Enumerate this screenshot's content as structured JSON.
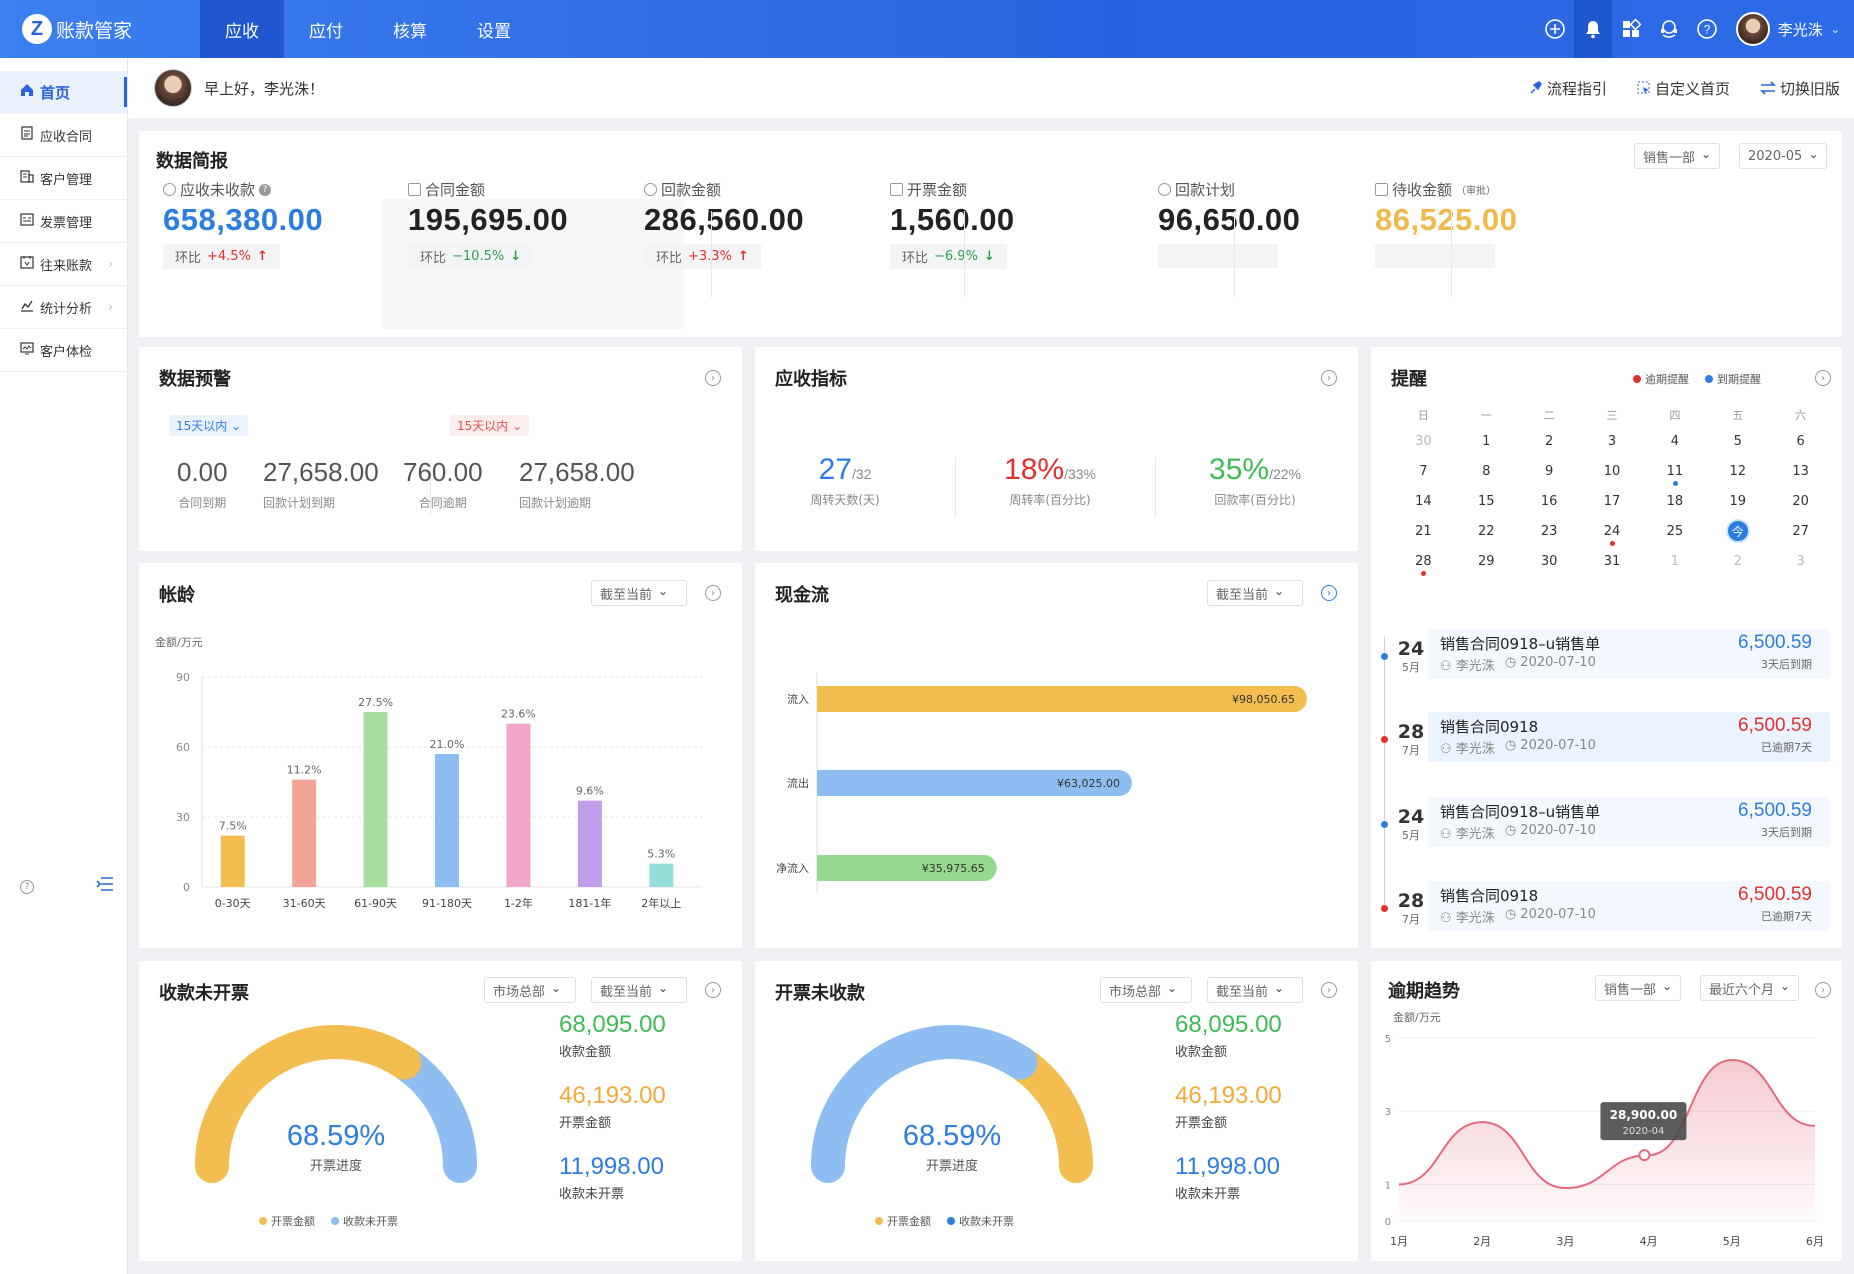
{
  "app": {
    "name": "账款管家",
    "logo_letter": "Z"
  },
  "topnav": {
    "tabs": [
      "应收",
      "应付",
      "核算",
      "设置"
    ],
    "active": 0
  },
  "user": {
    "name": "李光洙"
  },
  "sidebar": {
    "items": [
      {
        "label": "首页",
        "icon": "home-icon",
        "active": true
      },
      {
        "label": "应收合同",
        "icon": "document-icon"
      },
      {
        "label": "客户管理",
        "icon": "building-icon"
      },
      {
        "label": "发票管理",
        "icon": "invoice-icon"
      },
      {
        "label": "往来账款",
        "icon": "ledger-icon",
        "chevron": true
      },
      {
        "label": "统计分析",
        "icon": "chart-icon",
        "chevron": true
      },
      {
        "label": "客户体检",
        "icon": "monitor-icon"
      }
    ]
  },
  "greeting": {
    "text": "早上好，李光洙！",
    "links": [
      "流程指引",
      "自定义首页",
      "切换旧版"
    ]
  },
  "summary": {
    "title": "数据简报",
    "filters": [
      "销售一部",
      "2020-05"
    ],
    "stats": [
      {
        "label": "应收未收款",
        "value": "658,380.00",
        "color": "#2d7de0",
        "cmp_label": "环比",
        "cmp": "+4.5%",
        "trend": "up",
        "help": true
      },
      {
        "label": "合同金额",
        "value": "195,695.00",
        "color": "#222222",
        "cmp_label": "环比",
        "cmp": "−10.5%",
        "trend": "down"
      },
      {
        "label": "回款金额",
        "value": "286,560.00",
        "color": "#222222",
        "cmp_label": "环比",
        "cmp": "+3.3%",
        "trend": "up"
      },
      {
        "label": "开票金额",
        "value": "1,560.00",
        "color": "#222222",
        "cmp_label": "环比",
        "cmp": "−6.9%",
        "trend": "down"
      },
      {
        "label": "回款计划",
        "value": "96,650.00",
        "color": "#222222"
      },
      {
        "label": "待收金额",
        "label_note": "（审批）",
        "value": "86,525.00",
        "color": "#f0b94a"
      }
    ]
  },
  "warning": {
    "title": "数据预警",
    "tags": [
      "15天以内",
      "15天以内"
    ],
    "items": [
      {
        "value": "0.00",
        "label": "合同到期"
      },
      {
        "value": "27,658.00",
        "label": "回款计划到期"
      },
      {
        "value": "760.00",
        "label": "合同逾期"
      },
      {
        "value": "27,658.00",
        "label": "回款计划逾期"
      }
    ]
  },
  "indicators": {
    "title": "应收指标",
    "items": [
      {
        "value": "27",
        "total": "/32",
        "label": "周转天数(天)",
        "color": "#2d7de0"
      },
      {
        "value": "18%",
        "total": "/33%",
        "label": "周转率(百分比)",
        "color": "#e03030"
      },
      {
        "value": "35%",
        "total": "/22%",
        "label": "回款率(百分比)",
        "color": "#3dbb55"
      }
    ]
  },
  "reminder": {
    "title": "提醒",
    "legend": [
      {
        "label": "逾期提醒",
        "color": "#e03030"
      },
      {
        "label": "到期提醒",
        "color": "#2d7de0"
      }
    ],
    "weekdays": [
      "日",
      "一",
      "二",
      "三",
      "四",
      "五",
      "六"
    ],
    "weeks": [
      [
        "30",
        "1",
        "2",
        "3",
        "4",
        "5",
        "6"
      ],
      [
        "7",
        "8",
        "9",
        "10",
        "11",
        "12",
        "13"
      ],
      [
        "14",
        "15",
        "16",
        "17",
        "18",
        "19",
        "20"
      ],
      [
        "21",
        "22",
        "23",
        "24",
        "25",
        "今",
        "27"
      ],
      [
        "28",
        "29",
        "30",
        "31",
        "1",
        "2",
        "3"
      ]
    ],
    "items": [
      {
        "day": "24",
        "month": "5月",
        "title": "销售合同0918–u销售单",
        "user": "李光洙",
        "date": "2020-07-10",
        "amount": "6,500.59",
        "status": "3天后到期",
        "type": "due"
      },
      {
        "day": "28",
        "month": "7月",
        "title": "销售合同0918",
        "user": "李光洙",
        "date": "2020-07-10",
        "amount": "6,500.59",
        "status": "已逾期7天",
        "type": "overdue"
      },
      {
        "day": "24",
        "month": "5月",
        "title": "销售合同0918–u销售单",
        "user": "李光洙",
        "date": "2020-07-10",
        "amount": "6,500.59",
        "status": "3天后到期",
        "type": "due"
      },
      {
        "day": "28",
        "month": "7月",
        "title": "销售合同0918",
        "user": "李光洙",
        "date": "2020-07-10",
        "amount": "6,500.59",
        "status": "已逾期7天",
        "type": "overdue"
      }
    ]
  },
  "aging": {
    "title": "帐龄",
    "filter": "截至当前",
    "chart_data": {
      "type": "bar",
      "ylabel": "金额/万元",
      "ylim": [
        0,
        90
      ],
      "yticks": [
        "0",
        "30",
        "60",
        "90"
      ],
      "categories": [
        "0-30天",
        "31-60天",
        "61-90天",
        "91-180天",
        "1-2年",
        "181-1年",
        "2年以上"
      ],
      "values": [
        22,
        46,
        75,
        57,
        70,
        37,
        10
      ],
      "labels": [
        "7.5%",
        "11.2%",
        "27.5%",
        "21.0%",
        "23.6%",
        "9.6%",
        "5.3%"
      ],
      "colors": [
        "#f4bd4f",
        "#f2a596",
        "#a8e0a2",
        "#8ebdf2",
        "#f2a7c8",
        "#c19ce8",
        "#93dfdb"
      ]
    }
  },
  "cashflow": {
    "title": "现金流",
    "filter": "截至当前",
    "chart_data": {
      "type": "bar",
      "orientation": "horizontal",
      "categories": [
        "流入",
        "流出",
        "净流入"
      ],
      "values": [
        98050.65,
        63025.0,
        35975.65
      ],
      "labels": [
        "¥98,050.65",
        "¥63,025.00",
        "¥35,975.65"
      ],
      "colors": [
        "#f4bd4f",
        "#8ebdf2",
        "#94d98d"
      ]
    }
  },
  "gauge1": {
    "title": "收款未开票",
    "filters": [
      "市场总部",
      "截至当前"
    ],
    "percent": "68.59%",
    "percent_label": "开票进度",
    "fraction": 0.6859,
    "main_color": "#f4bd4f",
    "rest_color": "#8ebdf2",
    "legend": [
      {
        "label": "开票金额",
        "color": "#f4bd4f"
      },
      {
        "label": "收款未开票",
        "color": "#8ebdf2"
      }
    ],
    "stats": [
      {
        "value": "68,095.00",
        "label": "收款金额",
        "color": "#3dbb55"
      },
      {
        "value": "46,193.00",
        "label": "开票金额",
        "color": "#f0a93a"
      },
      {
        "value": "11,998.00",
        "label": "收款未开票",
        "color": "#2d7de0"
      }
    ]
  },
  "gauge2": {
    "title": "开票未收款",
    "filters": [
      "市场总部",
      "截至当前"
    ],
    "percent": "68.59%",
    "percent_label": "开票进度",
    "fraction": 0.6859,
    "main_color": "#8ebdf2",
    "rest_color": "#f4bd4f",
    "legend": [
      {
        "label": "开票金额",
        "color": "#f4bd4f"
      },
      {
        "label": "收款未开票",
        "color": "#2d7de0"
      }
    ],
    "stats": [
      {
        "value": "68,095.00",
        "label": "收款金额",
        "color": "#3dbb55"
      },
      {
        "value": "46,193.00",
        "label": "开票金额",
        "color": "#f0a93a"
      },
      {
        "value": "11,998.00",
        "label": "收款未开票",
        "color": "#2d7de0"
      }
    ]
  },
  "overdue": {
    "title": "逾期趋势",
    "filters": [
      "销售一部",
      "最近六个月"
    ],
    "tooltip": {
      "value": "28,900.00",
      "date": "2020-04"
    },
    "chart_data": {
      "type": "area",
      "ylabel": "金额/万元",
      "ylim": [
        0,
        5
      ],
      "yticks": [
        "0",
        "1",
        "3",
        "5"
      ],
      "categories": [
        "1月",
        "2月",
        "3月",
        "4月",
        "5月",
        "6月"
      ],
      "values": [
        1.0,
        2.7,
        0.9,
        1.8,
        4.4,
        2.6
      ],
      "color": "#e36a7c"
    }
  }
}
